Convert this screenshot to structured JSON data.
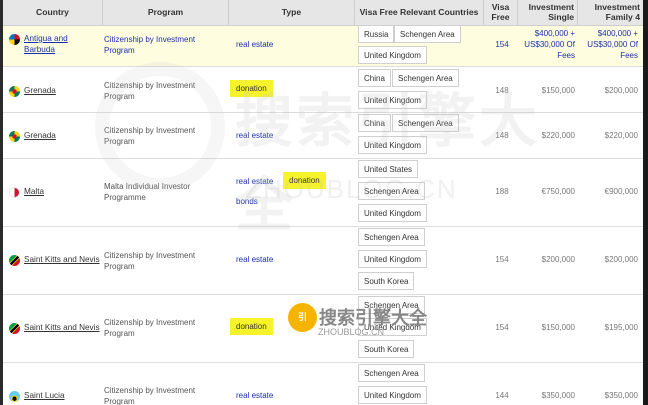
{
  "columns": {
    "country": "Country",
    "program": "Program",
    "type": "Type",
    "visa_free_countries": "Visa Free Relevant Countries",
    "visa_free_1": "Visa",
    "visa_free_2": "Free",
    "inv_single_1": "Investment",
    "inv_single_2": "Single",
    "inv_family_1": "Investment",
    "inv_family_2": "Family 4"
  },
  "rows": [
    {
      "country_1": "Antigua and",
      "country_2": "Barbuda",
      "program_1": "Citizenship by Investment",
      "program_2": "Program",
      "type_1": "real estate",
      "chips": [
        "Russia",
        "Schengen Area",
        "United Kingdom"
      ],
      "visa_free": "154",
      "single_1": "$400,000 +",
      "single_2": "US$30,000 Of",
      "single_3": "Fees",
      "family_1": "$400,000 +",
      "family_2": "US$30,000 Of",
      "family_3": "Fees"
    },
    {
      "country": "Grenada",
      "program_1": "Citizenship by Investment",
      "program_2": "Program",
      "type_1": "donation",
      "chips": [
        "China",
        "Schengen Area",
        "United Kingdom"
      ],
      "visa_free": "148",
      "single": "$150,000",
      "family": "$200,000"
    },
    {
      "country": "Grenada",
      "program_1": "Citizenship by Investment",
      "program_2": "Program",
      "type_1": "real estate",
      "chips": [
        "China",
        "Schengen Area",
        "United Kingdom"
      ],
      "visa_free": "148",
      "single": "$220,000",
      "family": "$220,000"
    },
    {
      "country": "Malta",
      "program_1": "Malta Individual Investor",
      "program_2": "Programme",
      "type_1": "real estate",
      "type_2": "donation",
      "type_3": "bonds",
      "chips": [
        "United States",
        "Schengen Area",
        "United Kingdom"
      ],
      "visa_free": "188",
      "single": "€750,000",
      "family": "€900,000"
    },
    {
      "country": "Saint Kitts and Nevis",
      "program_1": "Citizenship by Investment",
      "program_2": "Program",
      "type_1": "real estate",
      "chips": [
        "Schengen Area",
        "United Kingdom",
        "South Korea"
      ],
      "visa_free": "154",
      "single": "$200,000",
      "family": "$200,000"
    },
    {
      "country": "Saint Kitts and Nevis",
      "program_1": "Citizenship by Investment",
      "program_2": "Program",
      "type_1": "donation",
      "chips": [
        "Schengen Area",
        "United Kingdom",
        "South Korea"
      ],
      "visa_free": "154",
      "single": "$150,000",
      "family": "$195,000"
    },
    {
      "country": "Saint Lucia",
      "program_1": "Citizenship by Investment",
      "program_2": "Program",
      "type_1": "real estate",
      "chips": [
        "Schengen Area",
        "United Kingdom"
      ],
      "visa_free": "144",
      "single": "$350,000",
      "family": "$350,000"
    }
  ],
  "watermark": {
    "main": "搜索引擎大全",
    "sub": "ZHOUBLOG.CN",
    "logo_text": "搜索引擎大全",
    "logo_sub": "ZHOUBLOG.CN"
  },
  "colors": {
    "link": "#1a2fae",
    "highlight_row": "#fffde0",
    "donation_badge": "#f7f32a",
    "header_bg": "#e6e6e6"
  }
}
